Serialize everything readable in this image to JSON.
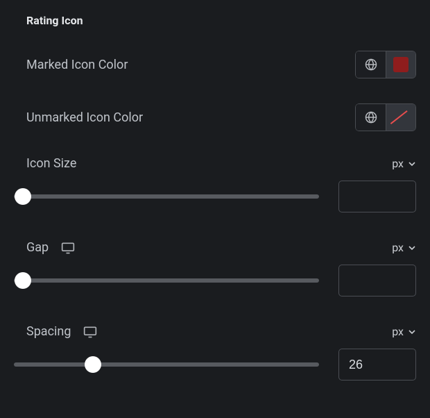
{
  "section": {
    "title": "Rating Icon"
  },
  "controls": {
    "markedColor": {
      "label": "Marked Icon Color",
      "swatch": "#8f1d1d",
      "hasColor": true
    },
    "unmarkedColor": {
      "label": "Unmarked Icon Color",
      "hasColor": false
    },
    "iconSize": {
      "label": "Icon Size",
      "unit": "px",
      "value": "",
      "sliderPercent": 3
    },
    "gap": {
      "label": "Gap",
      "unit": "px",
      "value": "",
      "sliderPercent": 3,
      "responsive": true
    },
    "spacing": {
      "label": "Spacing",
      "unit": "px",
      "value": "26",
      "sliderPercent": 26,
      "responsive": true
    }
  }
}
